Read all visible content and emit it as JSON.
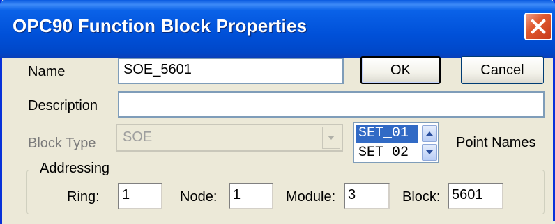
{
  "window": {
    "title": "OPC90 Function Block Properties"
  },
  "form": {
    "name_label": "Name",
    "name_value": "SOE_5601",
    "description_label": "Description",
    "description_value": "",
    "block_type_label": "Block Type",
    "block_type_value": "SOE",
    "point_names_label": "Point Names",
    "point_names": [
      "SET_01",
      "SET_02"
    ],
    "selected_point": "SET_01"
  },
  "buttons": {
    "ok_label": "OK",
    "cancel_label": "Cancel"
  },
  "addressing": {
    "group_label": "Addressing",
    "ring_label": "Ring:",
    "ring_value": "1",
    "node_label": "Node:",
    "node_value": "1",
    "module_label": "Module:",
    "module_value": "3",
    "block_label": "Block:",
    "block_value": "5601"
  },
  "colors": {
    "titlebar": "#0054e3",
    "close_button": "#e05a30",
    "selection": "#316ac5",
    "dialog_bg": "#ece9d8"
  },
  "icons": {
    "close": "close-icon",
    "combo_arrow": "chevron-down-icon",
    "scroll_up": "scroll-up-icon",
    "scroll_down": "scroll-down-icon"
  }
}
